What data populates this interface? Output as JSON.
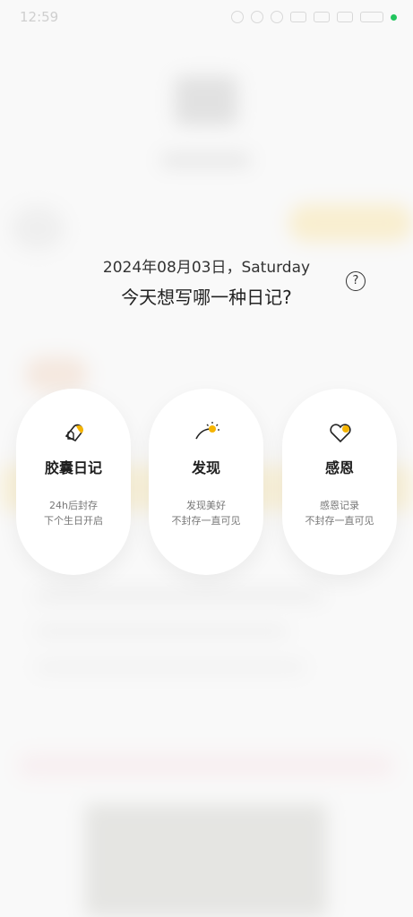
{
  "status_bar": {
    "time": "12:59"
  },
  "prompt": {
    "date": "2024年08月03日，Saturday",
    "question": "今天想写哪一种日记?",
    "help_symbol": "?"
  },
  "cards": [
    {
      "title": "胶囊日记",
      "line1": "24h后封存",
      "line2": "下个生日开启",
      "icon": "capsule-icon"
    },
    {
      "title": "发现",
      "line1": "发现美好",
      "line2": "不封存一直可见",
      "icon": "sunrise-icon"
    },
    {
      "title": "感恩",
      "line1": "感恩记录",
      "line2": "不封存一直可见",
      "icon": "heart-icon"
    }
  ],
  "colors": {
    "accent": "#f5b400",
    "text": "#222222"
  }
}
